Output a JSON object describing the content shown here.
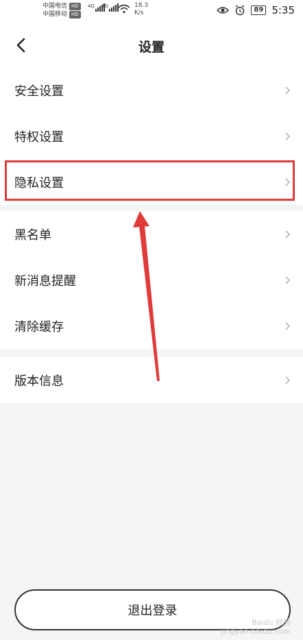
{
  "status_bar": {
    "carrier1": "中国电信",
    "carrier2": "中国移动",
    "hd_badge": "HD",
    "net1": "4G",
    "net2": "4G",
    "speed_value": "18.3",
    "speed_unit": "K/s",
    "battery": "89",
    "time": "5:35"
  },
  "header": {
    "title": "设置"
  },
  "groups": [
    {
      "items": [
        {
          "label": "安全设置"
        },
        {
          "label": "特权设置"
        },
        {
          "label": "隐私设置"
        }
      ]
    },
    {
      "items": [
        {
          "label": "黑名单"
        },
        {
          "label": "新消息提醒"
        },
        {
          "label": "清除缓存"
        }
      ]
    },
    {
      "items": [
        {
          "label": "版本信息"
        }
      ]
    }
  ],
  "logout": {
    "label": "退出登录"
  },
  "watermark": {
    "line1": "Baidu 经验",
    "line2": "jingyan.baidu.com"
  },
  "colors": {
    "highlight": "#e03b3b",
    "background": "#f5f5f5",
    "surface": "#ffffff"
  },
  "icons": {
    "back": "chevron-left-icon",
    "row": "chevron-right-icon"
  }
}
